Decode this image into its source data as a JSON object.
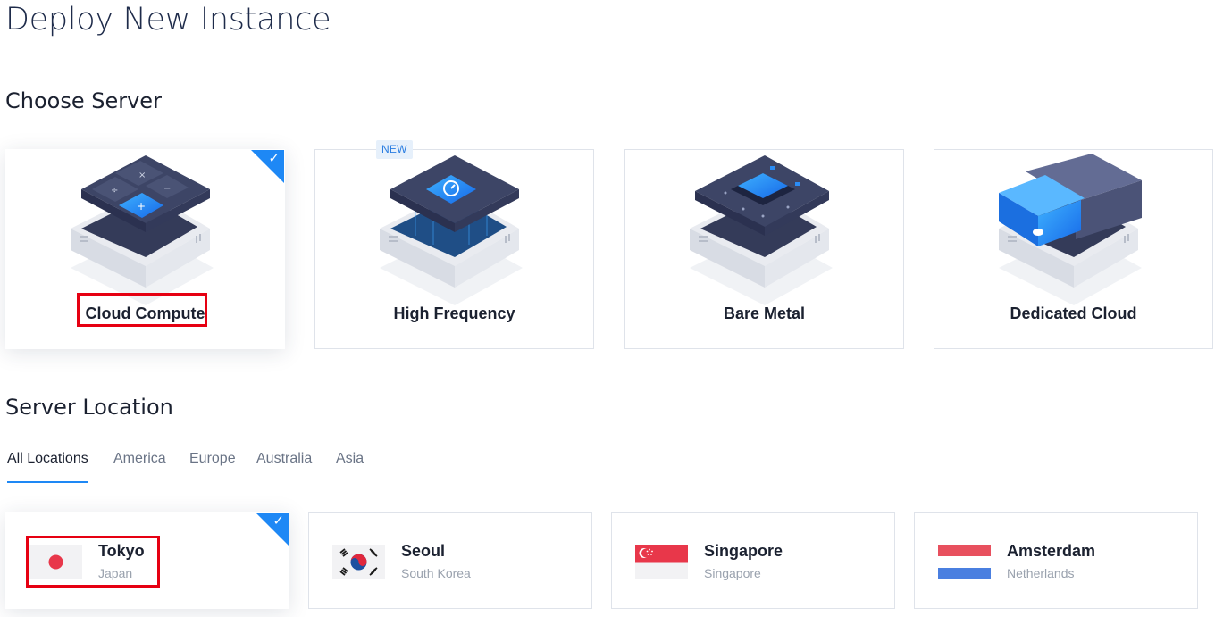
{
  "page": {
    "title": "Deploy New Instance"
  },
  "choose_server": {
    "title": "Choose Server",
    "new_badge": "NEW",
    "selected_check": "✓",
    "cards": [
      {
        "label": "Cloud Compute",
        "icon": "calculator-server-icon",
        "selected": true
      },
      {
        "label": "High Frequency",
        "icon": "speedometer-server-icon",
        "selected": false,
        "badge": "NEW"
      },
      {
        "label": "Bare Metal",
        "icon": "chip-server-icon",
        "selected": false
      },
      {
        "label": "Dedicated Cloud",
        "icon": "cloud-server-icon",
        "selected": false
      }
    ]
  },
  "server_location": {
    "title": "Server Location",
    "tabs": [
      {
        "label": "All Locations",
        "active": true
      },
      {
        "label": "America",
        "active": false
      },
      {
        "label": "Europe",
        "active": false
      },
      {
        "label": "Australia",
        "active": false
      },
      {
        "label": "Asia",
        "active": false
      }
    ],
    "locations": [
      {
        "city": "Tokyo",
        "country": "Japan",
        "flag": "japan-flag-icon",
        "selected": true
      },
      {
        "city": "Seoul",
        "country": "South Korea",
        "flag": "south-korea-flag-icon",
        "selected": false
      },
      {
        "city": "Singapore",
        "country": "Singapore",
        "flag": "singapore-flag-icon",
        "selected": false
      },
      {
        "city": "Amsterdam",
        "country": "Netherlands",
        "flag": "netherlands-flag-icon",
        "selected": false
      }
    ]
  },
  "colors": {
    "accent": "#1e88f5",
    "highlight": "#e60012",
    "title": "#1e2b4a",
    "muted": "#9aa2ae",
    "card_border": "#dfe3ea"
  }
}
